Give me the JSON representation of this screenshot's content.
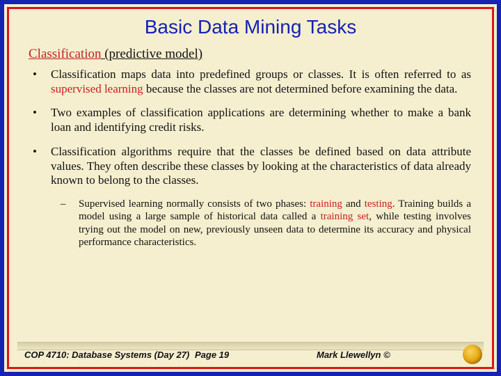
{
  "title": "Basic Data Mining Tasks",
  "subheading": {
    "red_underlined": "Classification",
    "rest": " (predictive model)"
  },
  "bullets": [
    {
      "pre": "Classification maps data into predefined groups or classes.  It is often referred to as ",
      "red": "supervised learning",
      "post": " because the classes are not determined before examining the data."
    },
    {
      "pre": "Two examples of classification applications are determining whether to make a bank loan and identifying credit risks.",
      "red": "",
      "post": ""
    },
    {
      "pre": "Classification algorithms require that the classes be defined based on data attribute values.  They often describe these classes by looking at the characteristics of data already known to belong to the classes.",
      "red": "",
      "post": ""
    }
  ],
  "sub_bullet": {
    "p1": "Supervised learning normally consists of two phases: ",
    "r1": "training",
    "p2": " and ",
    "r2": "testing",
    "p3": ". Training builds a model using a large sample of historical data called a ",
    "r3": "training set",
    "p4": ", while testing involves trying out the model on new, previously unseen data to determine its accuracy and physical performance characteristics."
  },
  "footer": {
    "left": "COP 4710: Database Systems (Day 27)",
    "center": "Page 19",
    "right": "Mark Llewellyn ©"
  }
}
